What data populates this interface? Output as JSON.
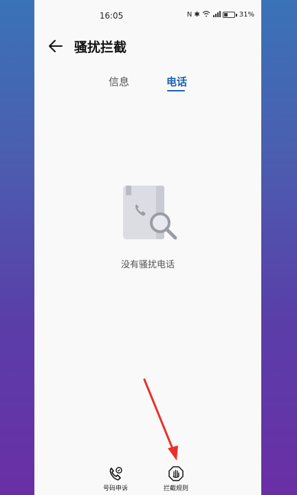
{
  "status_bar": {
    "time": "16:05",
    "battery": "31%",
    "icons": [
      "nfc-icon",
      "bluetooth-icon",
      "wifi-icon",
      "signal-icon",
      "battery-icon"
    ]
  },
  "header": {
    "title": "骚扰拦截",
    "back_icon": "back-arrow-icon"
  },
  "tabs": [
    {
      "label": "信息",
      "active": false
    },
    {
      "label": "电话",
      "active": true
    }
  ],
  "empty_state": {
    "message": "没有骚扰电话",
    "icon": "empty-call-log-search-icon"
  },
  "bottom_bar": {
    "items": [
      {
        "label": "号码申诉",
        "icon": "phone-appeal-icon"
      },
      {
        "label": "拦截规则",
        "icon": "hand-block-icon"
      }
    ]
  },
  "colors": {
    "accent": "#1a5fb4",
    "annotation_arrow": "#e8302a"
  }
}
